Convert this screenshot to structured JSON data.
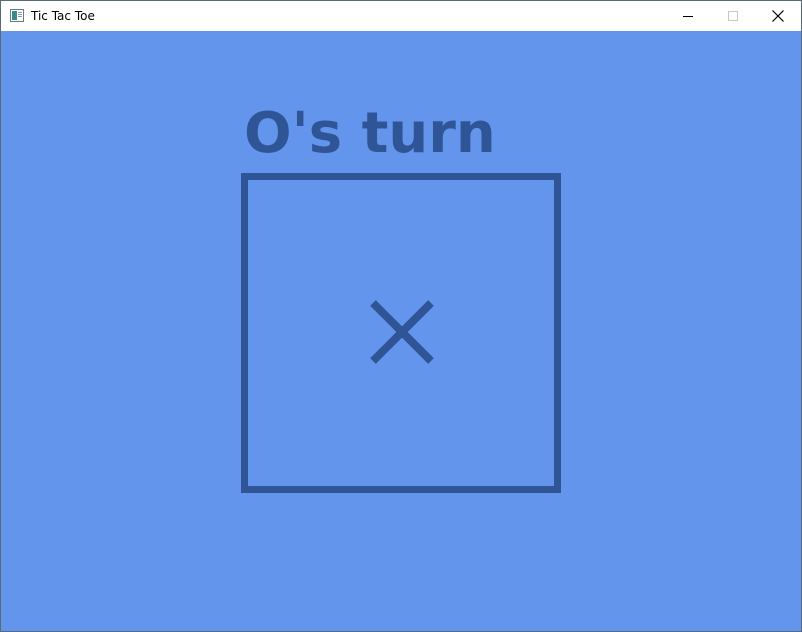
{
  "window": {
    "title": "Tic Tac Toe",
    "controls": [
      "minimize-icon",
      "maximize-icon",
      "close-icon"
    ]
  },
  "game": {
    "status_text": "O's turn",
    "background_color": "#6495ed",
    "ink_color": "#2f5597",
    "board": {
      "cells_shown": [
        {
          "mark": "X",
          "state": "placed"
        }
      ]
    }
  }
}
